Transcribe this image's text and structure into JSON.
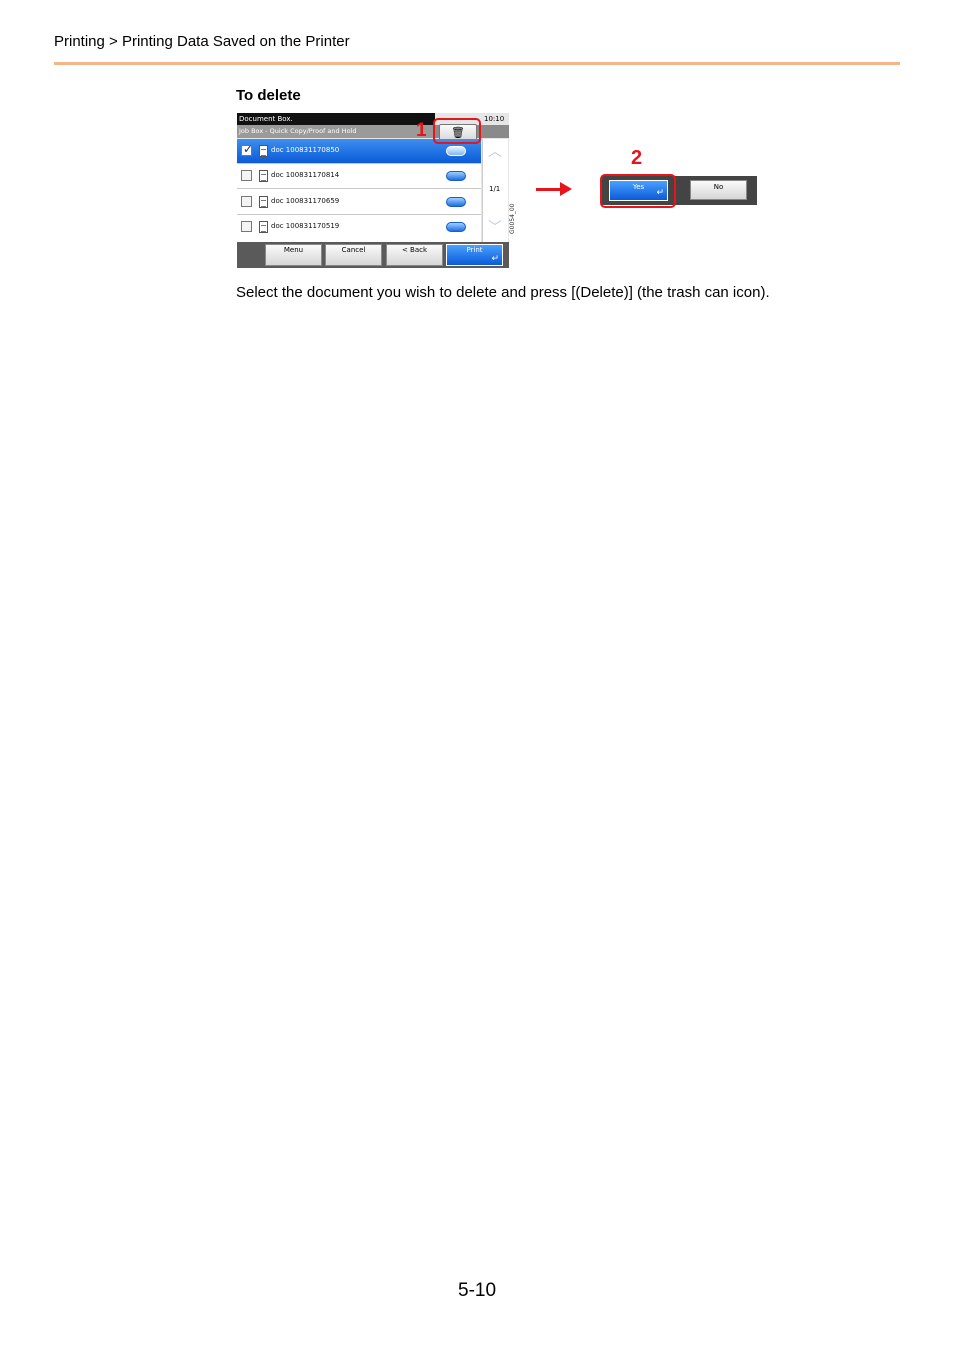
{
  "header": {
    "breadcrumb": "Printing > Printing Data Saved on the Printer"
  },
  "section": {
    "heading": "To delete"
  },
  "panel": {
    "title": "Document Box.",
    "subtitle": "Job Box - Quick Copy/Proof and Hold",
    "time": "10:10",
    "delete_icon": "trash-icon",
    "documents": [
      {
        "name": "doc 100831170850",
        "checked": true
      },
      {
        "name": "doc 100831170814",
        "checked": false
      },
      {
        "name": "doc 100831170659",
        "checked": false
      },
      {
        "name": "doc 100831170519",
        "checked": false
      }
    ],
    "page_indicator": "1/1",
    "buttons": {
      "menu": "Menu",
      "cancel": "Cancel",
      "back": "< Back",
      "print": "Print"
    },
    "image_id": "G0054_00"
  },
  "callouts": {
    "step1": "1",
    "step2": "2"
  },
  "confirm": {
    "yes": "Yes",
    "no": "No"
  },
  "body": {
    "instruction": "Select the document you wish to delete and press [(Delete)] (the trash can icon)."
  },
  "footer": {
    "page_number": "5-10"
  },
  "colors": {
    "accent_rule": "#f5b58a",
    "callout_red": "#e8141b",
    "selected_blue": "#0a5ad8"
  }
}
